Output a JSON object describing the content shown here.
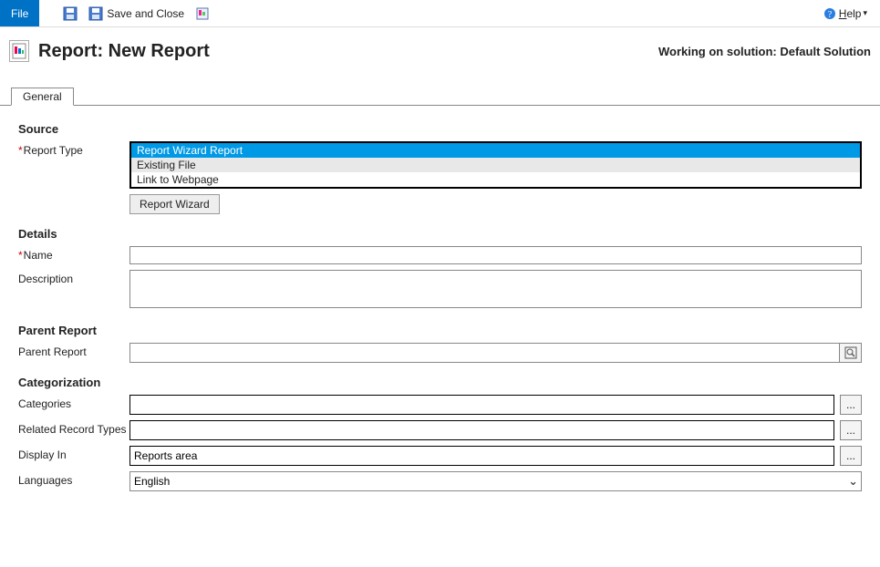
{
  "toolbar": {
    "file_label": "File",
    "save_and_close_label": "Save and Close",
    "help_label": "Help"
  },
  "header": {
    "title": "Report: New Report",
    "solution_text": "Working on solution: Default Solution"
  },
  "tabs": {
    "general_label": "General"
  },
  "sections": {
    "source_heading": "Source",
    "report_type_label": "Report Type",
    "report_type_options": {
      "0": "Report Wizard Report",
      "1": "Existing File",
      "2": "Link to Webpage"
    },
    "report_wizard_button": "Report Wizard",
    "details_heading": "Details",
    "name_label": "Name",
    "description_label": "Description",
    "parent_heading": "Parent Report",
    "parent_label": "Parent Report",
    "categorization_heading": "Categorization",
    "categories_label": "Categories",
    "related_types_label": "Related Record Types",
    "display_in_label": "Display In",
    "display_in_value": "Reports area",
    "languages_label": "Languages",
    "languages_value": "English"
  },
  "values": {
    "name": "",
    "description": "",
    "parent_report": "",
    "categories": "",
    "related_record_types": ""
  },
  "icons": {
    "ellipsis": "..."
  }
}
